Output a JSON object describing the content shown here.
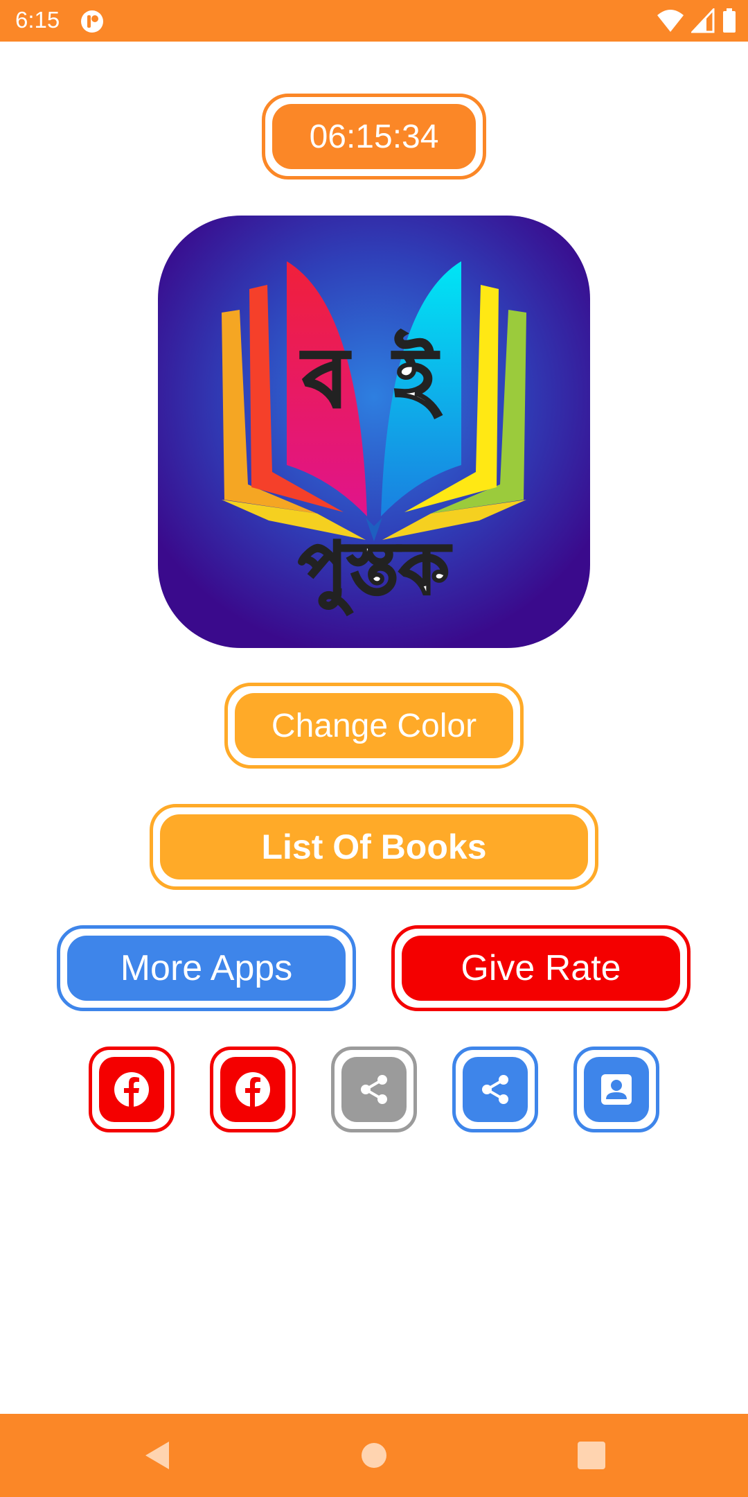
{
  "status_bar": {
    "time": "6:15",
    "icons": [
      "app-notification-icon",
      "wifi-icon",
      "cell-signal-icon",
      "battery-icon"
    ]
  },
  "clock": {
    "time": "06:15:34"
  },
  "logo": {
    "top_letters": "বই",
    "bottom_word": "পুস্তক",
    "colors": {
      "bg_center": "#2E6FD6",
      "bg_edge": "#3A0A8C"
    }
  },
  "buttons": {
    "change_color": "Change Color",
    "list_of_books": "List Of Books",
    "more_apps": "More Apps",
    "give_rate": "Give Rate"
  },
  "icon_buttons": [
    {
      "icon": "facebook-icon",
      "color": "#F40000"
    },
    {
      "icon": "facebook-icon",
      "color": "#F40000"
    },
    {
      "icon": "share-icon",
      "color": "#9B9B9B"
    },
    {
      "icon": "share-icon",
      "color": "#3E85EA"
    },
    {
      "icon": "account-icon",
      "color": "#3E85EA"
    }
  ],
  "nav_bar": {
    "icons": [
      "back-icon",
      "home-icon",
      "recents-icon"
    ]
  },
  "theme": {
    "orange": "#FB8727",
    "amber": "#FFAA28",
    "blue": "#3E85EA",
    "red": "#F40000",
    "gray": "#9B9B9B"
  }
}
